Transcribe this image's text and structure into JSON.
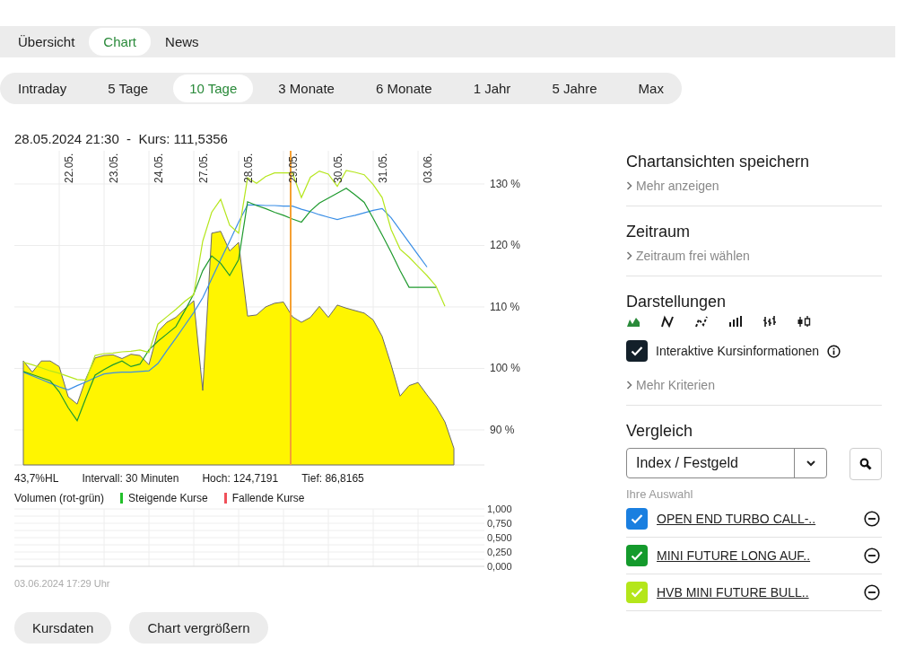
{
  "main_tabs": [
    {
      "label": "Übersicht",
      "selected": false
    },
    {
      "label": "Chart",
      "selected": true
    },
    {
      "label": "News",
      "selected": false
    }
  ],
  "periods": [
    {
      "label": "Intraday",
      "selected": false
    },
    {
      "label": "5 Tage",
      "selected": false
    },
    {
      "label": "10 Tage",
      "selected": true
    },
    {
      "label": "3 Monate",
      "selected": false
    },
    {
      "label": "6 Monate",
      "selected": false
    },
    {
      "label": "1 Jahr",
      "selected": false
    },
    {
      "label": "5 Jahre",
      "selected": false
    },
    {
      "label": "Max",
      "selected": false
    }
  ],
  "chart": {
    "header": "28.05.2024 21:30  -  Kurs: 111,5356",
    "chart_data": {
      "type": "area",
      "ylim": [
        84.3,
        135.4
      ],
      "categories": [
        null,
        null,
        null,
        null,
        null,
        "22.05.",
        null,
        null,
        null,
        null,
        "23.05.",
        null,
        null,
        null,
        null,
        "24.05.",
        null,
        null,
        null,
        null,
        "27.05.",
        null,
        null,
        null,
        null,
        "28.05.",
        null,
        null,
        null,
        null,
        "29.05.",
        null,
        null,
        null,
        null,
        "30.05.",
        null,
        null,
        null,
        null,
        "31.05.",
        null,
        null,
        null,
        null,
        "03.06.",
        null,
        null,
        null
      ],
      "yticks": [
        {
          "value": 90,
          "label": "90 %"
        },
        {
          "value": 100,
          "label": "100 %"
        },
        {
          "value": 110,
          "label": "110 %"
        },
        {
          "value": 120,
          "label": "120 %"
        },
        {
          "value": 130,
          "label": "130 %"
        }
      ],
      "grid": true,
      "series": [
        {
          "color": "#fff500",
          "values": [
            101.2,
            99.4,
            101.2,
            101.2,
            100.3,
            95.4,
            94.2,
            98.4,
            101.7,
            102.1,
            102.2,
            101.6,
            102.3,
            102.1,
            100.6,
            106,
            107.5,
            108.3,
            109.7,
            111,
            96.4,
            122,
            122.3,
            119.1,
            120.5,
            108.5,
            108.7,
            110,
            110.6,
            110.8,
            108.4,
            107.5,
            108.3,
            110.1,
            108.3,
            110.3,
            109.8,
            109.4,
            109,
            107.9,
            105.2,
            100.6,
            95.5,
            97.2,
            97.7,
            95.7,
            93.8,
            91.3,
            87
          ]
        },
        {
          "type": "line",
          "color": "#3a8ee6",
          "values": [
            99.4,
            98.8,
            98.2,
            97.6,
            97,
            96.5,
            97.2,
            97.8,
            98.5,
            99.1,
            99.3,
            99.4,
            99.4,
            99.5,
            99.6,
            100.8,
            102.9,
            104.9,
            107,
            109.1,
            111.5,
            114.6,
            117.7,
            120.7,
            123.8,
            126.6,
            126.6,
            126.5,
            126.5,
            126.4,
            126.4,
            125.9,
            125.5,
            125,
            124.6,
            124.2,
            124.6,
            124.9,
            125.3,
            125.7,
            126,
            124.5,
            122.5,
            120.5,
            118.5,
            116.5,
            null,
            null,
            null
          ]
        },
        {
          "type": "line",
          "color": "#1f9a2e",
          "values": [
            99.5,
            99,
            98.5,
            98,
            96.2,
            93.6,
            91.5,
            95.3,
            98.9,
            99.8,
            100.6,
            101.2,
            100.3,
            100.7,
            103,
            104.4,
            105.6,
            106.8,
            109.4,
            112.1,
            115.9,
            118.3,
            117.1,
            115.1,
            117.7,
            127.1,
            126.5,
            126,
            125.4,
            124.9,
            124.3,
            123.8,
            125.6,
            126.9,
            127.7,
            128.5,
            129.3,
            128.2,
            127,
            124.4,
            121.7,
            118.9,
            115.9,
            113.2,
            113.2,
            113.2,
            113.2,
            null,
            null
          ]
        },
        {
          "type": "line",
          "color": "#b5e61d",
          "values": [
            101,
            100.6,
            100.1,
            99.6,
            99.2,
            98.7,
            98.2,
            98.1,
            102.1,
            102.4,
            102.5,
            102.7,
            102.8,
            103,
            102.6,
            107.2,
            108.4,
            109.6,
            110.9,
            112,
            120.7,
            125.4,
            127.5,
            123.3,
            122,
            131,
            130.1,
            131.2,
            131.8,
            131.8,
            131.8,
            127.8,
            131.1,
            132.1,
            131.6,
            129.6,
            132.2,
            131.9,
            131.5,
            129.9,
            127.8,
            122.6,
            119.4,
            118.1,
            116.6,
            115.1,
            113.4,
            110.1,
            null
          ]
        }
      ]
    },
    "stats": [
      "43,7%HL",
      "Intervall: 30 Minuten",
      "Hoch: 124,7191",
      "Tief: 86,8165"
    ],
    "volume": {
      "title": "Volumen (rot-grün)",
      "legend": [
        {
          "label": "Steigende Kurse",
          "color": "#22c02a"
        },
        {
          "label": "Fallende Kurse",
          "color": "#f0505a"
        }
      ],
      "axis_labels": [
        "1,000",
        "0,750",
        "0,500",
        "0,250",
        "0,000"
      ]
    },
    "timestamp": "03.06.2024 17:29 Uhr",
    "buttons": [
      "Kursdaten",
      "Chart vergrößern"
    ]
  },
  "sidebar": {
    "save_views": {
      "title": "Chartansichten speichern",
      "link": "Mehr anzeigen"
    },
    "period": {
      "title": "Zeitraum",
      "link": "Zeitraum frei wählen"
    },
    "displays": {
      "title": "Darstellungen",
      "types": [
        {
          "kind": "area",
          "selected": true
        },
        {
          "kind": "line",
          "selected": false
        },
        {
          "kind": "dotted",
          "selected": false
        },
        {
          "kind": "bars",
          "selected": false
        },
        {
          "kind": "ohlc",
          "selected": false
        },
        {
          "kind": "candles",
          "selected": false
        }
      ],
      "interactive": {
        "label": "Interaktive Kursinformationen",
        "checked": true
      },
      "link": "Mehr Kriterien"
    },
    "compare": {
      "title": "Vergleich",
      "select": "Index / Festgeld",
      "caption": "Ihre Auswahl",
      "items": [
        {
          "label": "OPEN END TURBO CALL-..",
          "color": "#1a7fe0",
          "checked": true
        },
        {
          "label": "MINI FUTURE LONG AUF..",
          "color": "#149a2c",
          "checked": true
        },
        {
          "label": "HVB MINI FUTURE BULL..",
          "color": "#b4e61a",
          "checked": true
        }
      ]
    }
  }
}
